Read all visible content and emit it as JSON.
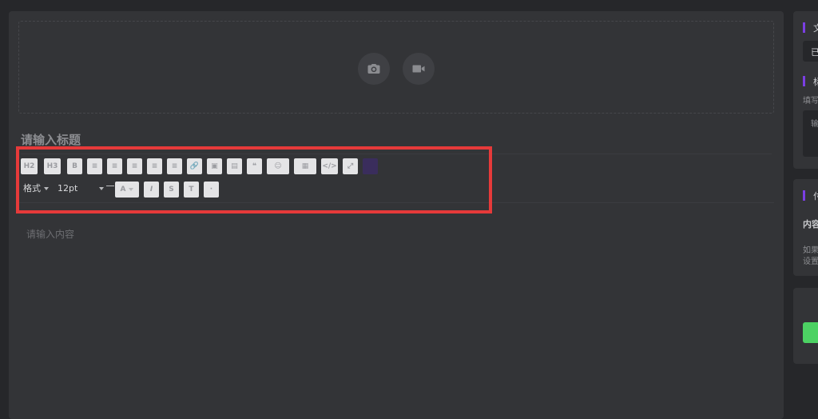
{
  "upload": {
    "photo_icon": "camera-icon",
    "video_icon": "video-icon"
  },
  "title_placeholder": "请输入标题",
  "toolbar": {
    "row1": [
      {
        "name": "h2-button",
        "label": "H2"
      },
      {
        "name": "h3-button",
        "label": "H3"
      },
      {
        "name": "bold-button",
        "label": "B"
      },
      {
        "name": "unordered-list-button",
        "label": "≡"
      },
      {
        "name": "ordered-list-button",
        "label": "≡"
      },
      {
        "name": "align-left-button",
        "label": "≡"
      },
      {
        "name": "align-center-button",
        "label": "≡"
      },
      {
        "name": "align-right-button",
        "label": "≡"
      },
      {
        "name": "link-button",
        "label": "🔗"
      },
      {
        "name": "image-button",
        "label": "▣"
      },
      {
        "name": "file-button",
        "label": "▤"
      },
      {
        "name": "quote-button",
        "label": "❝"
      },
      {
        "name": "emoji-dropdown-button",
        "label": "☺"
      },
      {
        "name": "media-dropdown-button",
        "label": "▦"
      },
      {
        "name": "code-button",
        "label": "</>"
      },
      {
        "name": "fullscreen-button",
        "label": "⤢"
      }
    ],
    "format_label": "格式",
    "font_size": "12pt",
    "row2": [
      {
        "name": "italic-button",
        "label": "I"
      },
      {
        "name": "strikethrough-button",
        "label": "S"
      },
      {
        "name": "clear-format-button",
        "label": "T"
      },
      {
        "name": "more-button",
        "label": "·"
      }
    ]
  },
  "content_placeholder": "请输入内容",
  "side": {
    "card1": {
      "heading": "文",
      "field_text": "已"
    },
    "card1b": {
      "heading": "标",
      "hint": "填写",
      "field_text": "输"
    },
    "card2": {
      "heading": "付",
      "label": "内容",
      "note_line1": "如果",
      "note_line2": "设置"
    }
  }
}
